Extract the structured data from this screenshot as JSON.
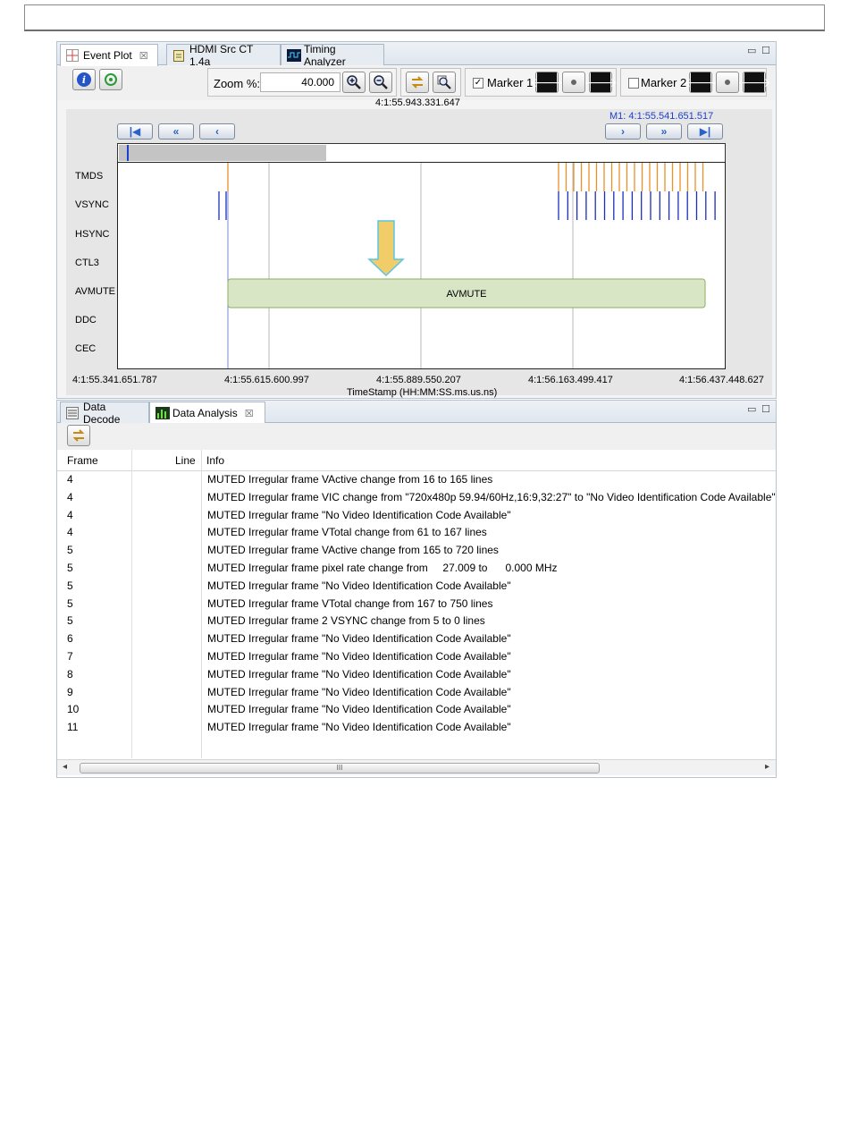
{
  "upper_tabs": [
    {
      "label": "Event Plot",
      "close": "☒"
    },
    {
      "label": "HDMI Src CT 1.4a"
    },
    {
      "label": "Timing Analyzer"
    }
  ],
  "window_controls": {
    "minimize": "▭",
    "maximize": "☐"
  },
  "toolbar": {
    "zoom_label": "Zoom %:",
    "zoom_value": "40.000",
    "marker1_label": "Marker 1",
    "marker1_checked": "✓",
    "marker2_label": "Marker 2"
  },
  "plot": {
    "center_timestamp": "4:1:55.943.331.647",
    "m1_label": "M1:  4:1:55.541.651.517",
    "signals": [
      "TMDS",
      "VSYNC",
      "HSYNC",
      "CTL3",
      "AVMUTE",
      "DDC",
      "CEC"
    ],
    "avmute_bar_label": "AVMUTE",
    "tick_labels": [
      "4:1:55.341.651.787",
      "4:1:55.615.600.997",
      "4:1:55.889.550.207",
      "4:1:56.163.499.417",
      "4:1:56.437.448.627"
    ],
    "axis_label": "TimeStamp (HH:MM:SS.ms.us.ns)",
    "colors": {
      "tmds": "#e8922a",
      "vsync": "#1b2fb8",
      "avmute_fill": "#d9e6c6",
      "avmute_border": "#8fad62",
      "arrow_fill": "#f1cd6a",
      "arrow_border": "#57c6e8"
    }
  },
  "lower_tabs": [
    {
      "label": "Data Decode"
    },
    {
      "label": "Data Analysis",
      "close": "☒"
    }
  ],
  "table": {
    "headers": {
      "frame": "Frame",
      "line": "Line",
      "info": "Info"
    },
    "rows": [
      {
        "frame": "4",
        "info": "MUTED Irregular frame VActive change from 16 to 165 lines"
      },
      {
        "frame": "4",
        "info": "MUTED Irregular frame VIC change from \"720x480p 59.94/60Hz,16:9,32:27\" to \"No Video Identification Code Available\""
      },
      {
        "frame": "4",
        "info": "MUTED Irregular frame \"No Video Identification Code Available\""
      },
      {
        "frame": "4",
        "info": "MUTED Irregular frame VTotal change from 61 to 167 lines"
      },
      {
        "frame": "5",
        "info": "MUTED Irregular frame VActive change from 165 to 720 lines"
      },
      {
        "frame": "5",
        "info": "MUTED Irregular frame pixel rate change from     27.009 to      0.000 MHz"
      },
      {
        "frame": "5",
        "info": "MUTED Irregular frame \"No Video Identification Code Available\""
      },
      {
        "frame": "5",
        "info": "MUTED Irregular frame VTotal change from 167 to 750 lines"
      },
      {
        "frame": "5",
        "info": "MUTED Irregular frame 2 VSYNC change from 5 to 0 lines"
      },
      {
        "frame": "6",
        "info": "MUTED Irregular frame \"No Video Identification Code Available\""
      },
      {
        "frame": "7",
        "info": "MUTED Irregular frame \"No Video Identification Code Available\""
      },
      {
        "frame": "8",
        "info": "MUTED Irregular frame \"No Video Identification Code Available\""
      },
      {
        "frame": "9",
        "info": "MUTED Irregular frame \"No Video Identification Code Available\""
      },
      {
        "frame": "10",
        "info": "MUTED Irregular frame \"No Video Identification Code Available\""
      },
      {
        "frame": "11",
        "info": "MUTED Irregular frame \"No Video Identification Code Available\""
      }
    ]
  },
  "scrollbar": {
    "thumb_grip": "III",
    "left_arrow": "◂",
    "right_arrow": "▸"
  }
}
